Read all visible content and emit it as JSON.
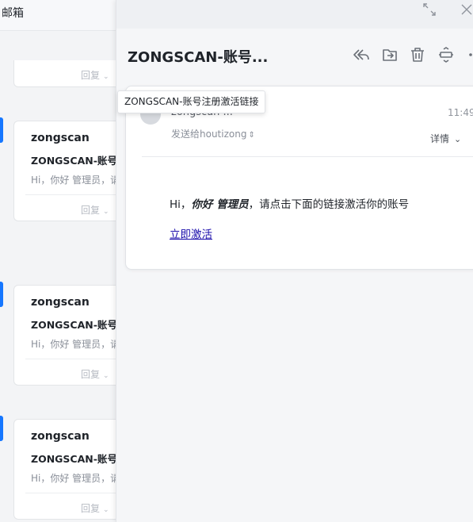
{
  "left": {
    "title": "邮箱",
    "cards": [
      {
        "sender": "zongscan",
        "subject": "ZONGSCAN-账号注",
        "preview": "Hi，你好 管理员，请",
        "reply": "回复"
      },
      {
        "sender": "zongscan",
        "subject": "ZONGSCAN-账号注",
        "preview": "Hi，你好 管理员，请",
        "reply": "回复"
      },
      {
        "sender": "zongscan",
        "subject": "ZONGSCAN-账号注",
        "preview": "Hi，你好 管理员，请",
        "reply": "回复"
      }
    ],
    "top_partial_reply": "回复"
  },
  "reader": {
    "subject": "ZONGSCAN-账号...",
    "tooltip": "ZONGSCAN-账号注册激活链接",
    "from": "zongscan ...",
    "time": "11:49",
    "recipient": "发送给houtizong",
    "details": "详情",
    "body_hi": "Hi，",
    "body_em": "你好 管理员",
    "body_rest": "，请点击下面的链接激活你的账号",
    "link": "立即激活"
  },
  "icons": {
    "expand": "expand-icon",
    "close": "close-icon",
    "reply_all": "reply-all-icon",
    "move": "move-to-folder-icon",
    "delete": "trash-icon",
    "mark": "mark-icon",
    "more": "more-icon"
  },
  "colors": {
    "accent": "#1677ff",
    "link": "#1a0dab"
  }
}
